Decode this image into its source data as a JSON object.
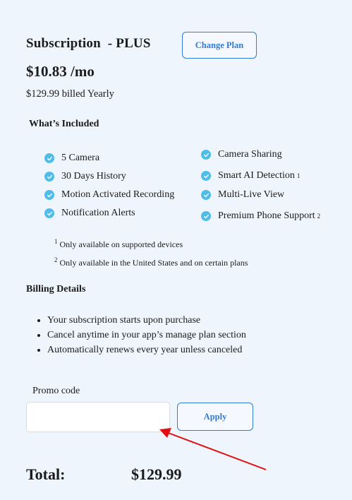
{
  "plan": {
    "title": "Subscription  - PLUS",
    "change_plan_label": "Change Plan",
    "price": "$10.83 /mo",
    "billed": "$129.99 billed Yearly"
  },
  "included": {
    "title": "What’s Included",
    "left_features": [
      {
        "label": "5 Camera",
        "sup": ""
      },
      {
        "label": "30 Days History",
        "sup": ""
      },
      {
        "label": "Motion Activated Recording",
        "sup": ""
      },
      {
        "label": "Notification Alerts",
        "sup": ""
      }
    ],
    "right_features": [
      {
        "label": "Camera Sharing",
        "sup": ""
      },
      {
        "label": "Smart AI Detection",
        "sup": "1"
      },
      {
        "label": "Multi-Live View",
        "sup": ""
      },
      {
        "label": "Premium Phone Support",
        "sup": "2"
      }
    ],
    "footnotes": [
      {
        "sup": "1",
        "text": "Only available on supported devices"
      },
      {
        "sup": "2",
        "text": "Only available in the United States and on certain plans"
      }
    ]
  },
  "billing": {
    "title": "Billing Details",
    "items": [
      "Your subscription starts upon purchase",
      "Cancel anytime in your app’s manage plan section",
      "Automatically renews every year unless canceled"
    ]
  },
  "promo": {
    "label": "Promo code",
    "value": "",
    "placeholder": "",
    "apply_label": "Apply"
  },
  "total": {
    "label": "Total:",
    "value": "$129.99"
  },
  "colors": {
    "background": "#eef5fc",
    "accent": "#2f7bd6",
    "check": "#4fbde9",
    "arrow": "#e01010"
  }
}
